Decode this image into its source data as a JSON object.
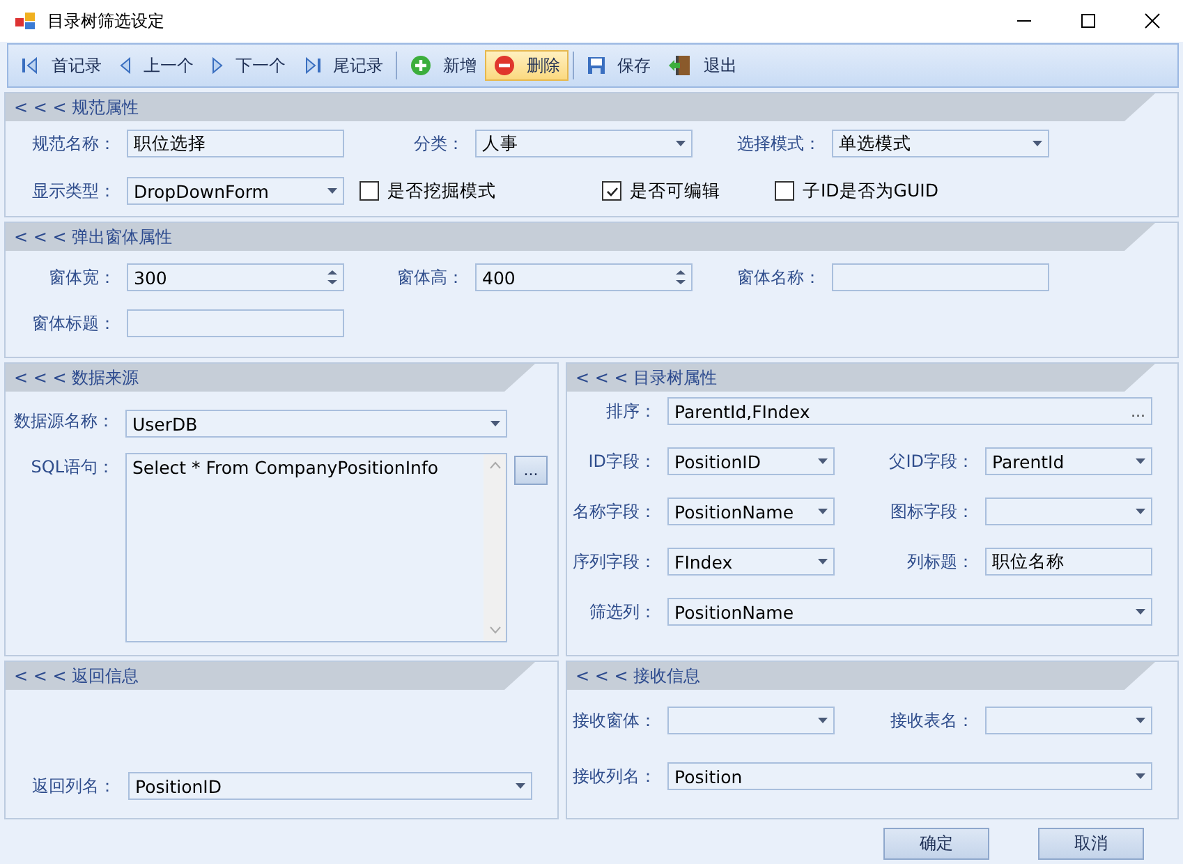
{
  "window": {
    "title": "目录树筛选设定"
  },
  "toolbar": [
    [
      {
        "kind": "first",
        "label": "首记录",
        "highlighted": false
      },
      {
        "kind": "prev",
        "label": "上一个",
        "highlighted": false
      },
      {
        "kind": "next",
        "label": "下一个",
        "highlighted": false
      },
      {
        "kind": "last",
        "label": "尾记录",
        "highlighted": false
      }
    ],
    [
      {
        "kind": "add",
        "label": "新增",
        "highlighted": false
      },
      {
        "kind": "delete",
        "label": "删除",
        "highlighted": true
      }
    ],
    [
      {
        "kind": "save",
        "label": "保存",
        "highlighted": false
      },
      {
        "kind": "exit",
        "label": "退出",
        "highlighted": false
      }
    ]
  ],
  "spec": {
    "title": "< < < 规范属性",
    "fields": [
      {
        "label": "规范名称：",
        "kind": "text",
        "value": "职位选择"
      },
      {
        "label": "分类：",
        "kind": "combo",
        "value": "人事"
      },
      {
        "label": "选择模式：",
        "kind": "combo",
        "value": "单选模式"
      },
      {
        "label": "显示类型：",
        "kind": "combo",
        "value": "DropDownForm"
      }
    ],
    "checks": [
      {
        "label": "是否挖掘模式",
        "checked": false
      },
      {
        "label": "是否可编辑",
        "checked": true
      },
      {
        "label": "子ID是否为GUID",
        "checked": false
      }
    ]
  },
  "popup": {
    "title": "< < < 弹出窗体属性",
    "fields": [
      {
        "label": "窗体宽：",
        "kind": "spin",
        "value": "300"
      },
      {
        "label": "窗体高：",
        "kind": "spin",
        "value": "400"
      },
      {
        "label": "窗体名称：",
        "kind": "text"
      },
      {
        "label": "窗体标题：",
        "kind": "text"
      }
    ]
  },
  "datasource": {
    "title": "< < < 数据来源",
    "fields": [
      {
        "label": "数据源名称：",
        "kind": "combo",
        "value": "UserDB"
      },
      {
        "label": "SQL语句：",
        "kind": "memo",
        "value": "Select * From CompanyPositionInfo",
        "button": "..."
      }
    ]
  },
  "tree": {
    "title": "< < < 目录树属性",
    "fields": [
      {
        "label": "排序：",
        "kind": "buttonedit",
        "value": "ParentId,FIndex",
        "button": "..."
      },
      {
        "label": "ID字段：",
        "kind": "combo",
        "value": "PositionID"
      },
      {
        "label": "父ID字段：",
        "kind": "combo",
        "value": "ParentId"
      },
      {
        "label": "名称字段：",
        "kind": "combo",
        "value": "PositionName"
      },
      {
        "label": "图标字段：",
        "kind": "combo"
      },
      {
        "label": "序列字段：",
        "kind": "combo",
        "value": "FIndex"
      },
      {
        "label": "列标题：",
        "kind": "text",
        "value": "职位名称"
      },
      {
        "label": "筛选列：",
        "kind": "combo",
        "value": "PositionName"
      }
    ]
  },
  "return": {
    "title": "< < < 返回信息",
    "fields": [
      {
        "label": "返回列名：",
        "kind": "combo",
        "value": "PositionID"
      }
    ]
  },
  "receive": {
    "title": "< < < 接收信息",
    "fields": [
      {
        "label": "接收窗体：",
        "kind": "combo"
      },
      {
        "label": "接收表名：",
        "kind": "combo"
      },
      {
        "label": "接收列名：",
        "kind": "combo",
        "value": "Position"
      }
    ]
  },
  "buttons": [
    "确定",
    "取消"
  ]
}
